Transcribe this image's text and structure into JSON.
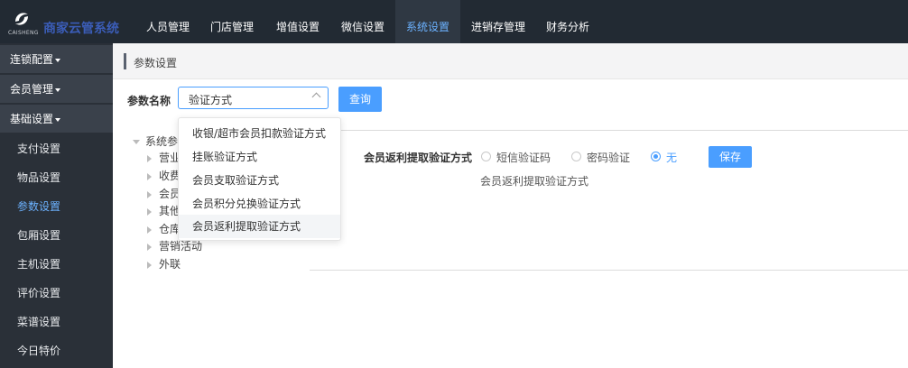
{
  "brand": {
    "title": "商家云管系统",
    "sub": "CAISHENG",
    "accent": "#3b5db8"
  },
  "topnav": {
    "items": [
      "人员管理",
      "门店管理",
      "增值设置",
      "微信设置",
      "系统设置",
      "进销存管理",
      "财务分析"
    ],
    "active": "系统设置"
  },
  "sidebar": {
    "groups": [
      "连锁配置",
      "会员管理",
      "基础设置"
    ],
    "items": [
      "支付设置",
      "物品设置",
      "参数设置",
      "包厢设置",
      "主机设置",
      "评价设置",
      "菜谱设置",
      "今日特价"
    ],
    "active": "参数设置"
  },
  "breadcrumb": "参数设置",
  "filter": {
    "label": "参数名称",
    "selected": "验证方式",
    "query_button": "查询"
  },
  "dropdown": {
    "options": [
      "收银/超市会员扣款验证方式",
      "挂账验证方式",
      "会员支取验证方式",
      "会员积分兑换验证方式",
      "会员返利提取验证方式"
    ],
    "highlighted": "会员返利提取验证方式"
  },
  "tree": {
    "root": "系统参",
    "children": [
      "营业",
      "收费",
      "会员",
      "其他",
      "仓库",
      "营销活动",
      "外联"
    ]
  },
  "form": {
    "label": "会员返利提取验证方式",
    "options": [
      "短信验证码",
      "密码验证",
      "无"
    ],
    "selected": "无",
    "description": "会员返利提取验证方式",
    "save_button": "保存"
  },
  "colors": {
    "primary": "#4a9eff",
    "topnav_bg": "#222a33",
    "sidebar_bg": "#2a3038"
  }
}
